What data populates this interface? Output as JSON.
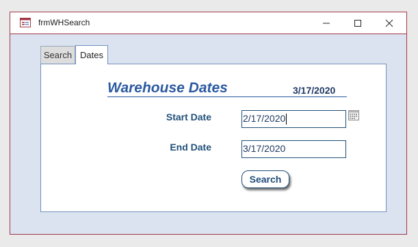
{
  "window": {
    "title": "frmWHSearch",
    "icon": "access-form-icon",
    "controls": [
      "minimize-icon",
      "maximize-icon",
      "close-icon"
    ]
  },
  "tabs": [
    {
      "label": "Search",
      "active": false
    },
    {
      "label": "Dates",
      "active": true
    }
  ],
  "form": {
    "heading": "Warehouse Dates",
    "today": "3/17/2020",
    "start_label": "Start Date",
    "start_value": "2/17/2020",
    "end_label": "End Date",
    "end_value": "3/17/2020",
    "search_label": "Search",
    "date_picker_icon": "calendar-icon"
  },
  "colors": {
    "border_accent": "#a33546",
    "form_background": "#dbe3f0",
    "label_color": "#1f4e79",
    "heading_color": "#2c5aa0"
  }
}
